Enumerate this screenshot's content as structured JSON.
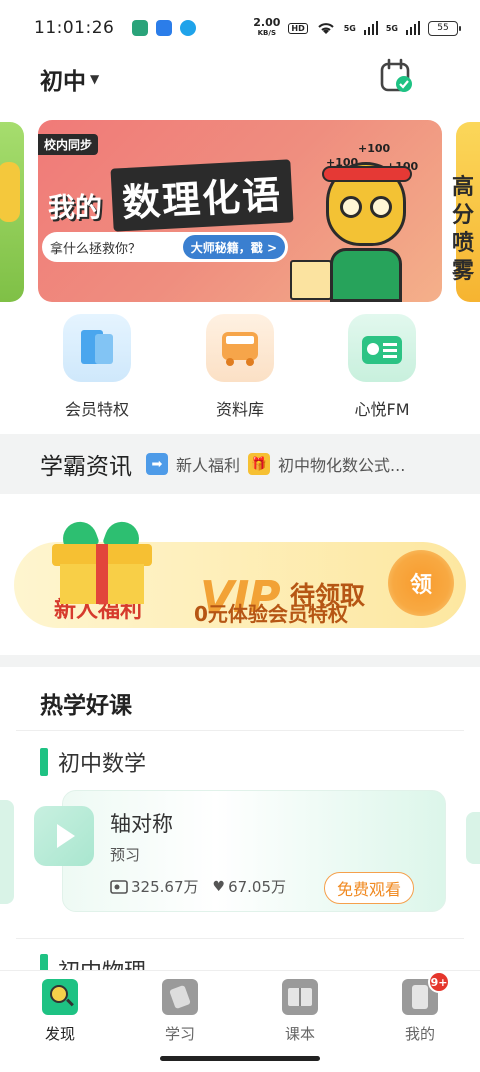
{
  "status_bar": {
    "time": "11:01:26",
    "speed_value": "2.00",
    "speed_unit": "KB/S",
    "hd_label": "HD",
    "signal_1": "5G",
    "signal_2": "5G",
    "battery": "55"
  },
  "header": {
    "grade_label": "初中",
    "calendar_icon": "calendar-check-icon"
  },
  "banner": {
    "tag": "校内同步",
    "title_small": "我的",
    "title_big": "数理化语",
    "pill_text": "拿什么拯救你？",
    "pill_cta": "大师秘籍，戳 >",
    "plus_label": "+100",
    "side_text": "高分喷雾",
    "colors": {
      "primary": "#f07a78",
      "accent": "#3a7fd0"
    }
  },
  "quick_links": [
    {
      "label": "会员特权",
      "icon": "book-icon"
    },
    {
      "label": "资料库",
      "icon": "bus-icon"
    },
    {
      "label": "心悦FM",
      "icon": "radio-icon"
    }
  ],
  "news": {
    "title": "学霸资讯",
    "items": [
      "新人福利",
      "初中物化数公式..."
    ]
  },
  "vip_banner": {
    "new_user_label": "新人福利",
    "vip_logo": "VIP",
    "claim_text": "待领取",
    "subtitle": "0元体验会员特权",
    "button_label": "领"
  },
  "hot_courses": {
    "title": "热学好课",
    "sections": [
      {
        "name": "初中数学",
        "course": {
          "title": "轴对称",
          "subtitle": "预习",
          "views": "325.67万",
          "likes": "67.05万",
          "action": "免费观看"
        }
      },
      {
        "name": "初中物理"
      }
    ]
  },
  "bottom_nav": {
    "items": [
      {
        "label": "发现",
        "icon": "discover-icon",
        "active": true
      },
      {
        "label": "学习",
        "icon": "study-icon"
      },
      {
        "label": "课本",
        "icon": "textbook-icon"
      },
      {
        "label": "我的",
        "icon": "profile-icon",
        "badge": "9+"
      }
    ]
  },
  "theme": {
    "accent_green": "#1ec283",
    "accent_orange": "#f08a22"
  }
}
